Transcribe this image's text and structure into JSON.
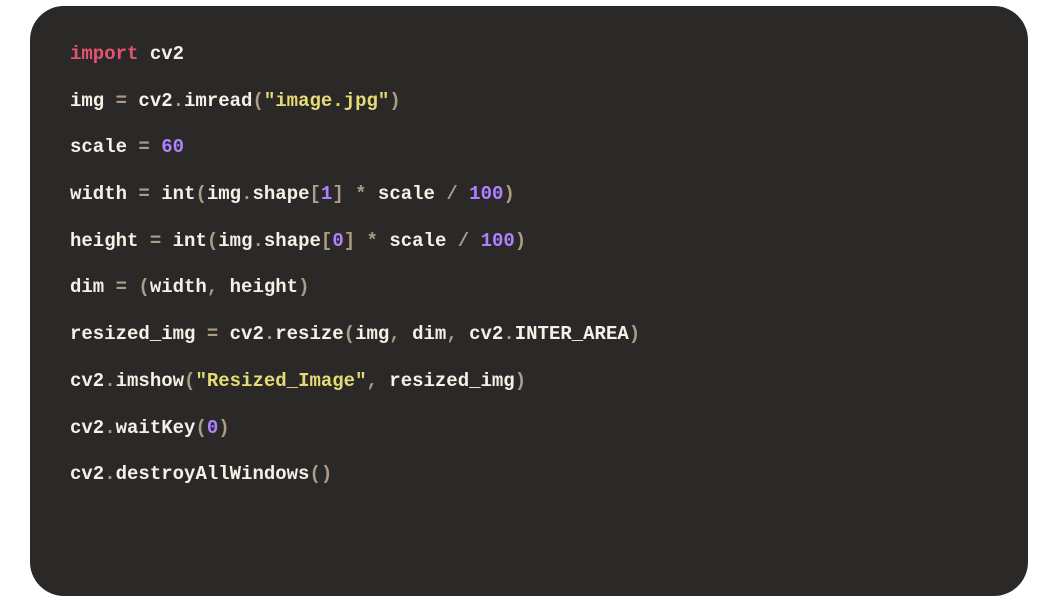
{
  "code": {
    "lines": [
      {
        "tokens": [
          {
            "c": "tok-keyword",
            "t": "import"
          },
          {
            "c": "tok-default",
            "t": " cv2"
          }
        ]
      },
      {
        "tokens": [
          {
            "c": "tok-default",
            "t": "img "
          },
          {
            "c": "tok-punct",
            "t": "="
          },
          {
            "c": "tok-default",
            "t": " cv2"
          },
          {
            "c": "tok-punct",
            "t": "."
          },
          {
            "c": "tok-func",
            "t": "imread"
          },
          {
            "c": "tok-punct",
            "t": "("
          },
          {
            "c": "tok-string",
            "t": "\"image.jpg\""
          },
          {
            "c": "tok-punct",
            "t": ")"
          }
        ]
      },
      {
        "tokens": [
          {
            "c": "tok-default",
            "t": "scale "
          },
          {
            "c": "tok-punct",
            "t": "="
          },
          {
            "c": "tok-default",
            "t": " "
          },
          {
            "c": "tok-number",
            "t": "60"
          }
        ]
      },
      {
        "tokens": [
          {
            "c": "tok-default",
            "t": "width "
          },
          {
            "c": "tok-punct",
            "t": "="
          },
          {
            "c": "tok-default",
            "t": " "
          },
          {
            "c": "tok-func",
            "t": "int"
          },
          {
            "c": "tok-punct",
            "t": "("
          },
          {
            "c": "tok-default",
            "t": "img"
          },
          {
            "c": "tok-punct",
            "t": "."
          },
          {
            "c": "tok-default",
            "t": "shape"
          },
          {
            "c": "tok-punct",
            "t": "["
          },
          {
            "c": "tok-number",
            "t": "1"
          },
          {
            "c": "tok-punct",
            "t": "]"
          },
          {
            "c": "tok-default",
            "t": " "
          },
          {
            "c": "tok-punct",
            "t": "*"
          },
          {
            "c": "tok-default",
            "t": " scale "
          },
          {
            "c": "tok-punct",
            "t": "/"
          },
          {
            "c": "tok-default",
            "t": " "
          },
          {
            "c": "tok-number",
            "t": "100"
          },
          {
            "c": "tok-punct",
            "t": ")"
          }
        ]
      },
      {
        "tokens": [
          {
            "c": "tok-default",
            "t": "height "
          },
          {
            "c": "tok-punct",
            "t": "="
          },
          {
            "c": "tok-default",
            "t": " "
          },
          {
            "c": "tok-func",
            "t": "int"
          },
          {
            "c": "tok-punct",
            "t": "("
          },
          {
            "c": "tok-default",
            "t": "img"
          },
          {
            "c": "tok-punct",
            "t": "."
          },
          {
            "c": "tok-default",
            "t": "shape"
          },
          {
            "c": "tok-punct",
            "t": "["
          },
          {
            "c": "tok-number",
            "t": "0"
          },
          {
            "c": "tok-punct",
            "t": "]"
          },
          {
            "c": "tok-default",
            "t": " "
          },
          {
            "c": "tok-punct",
            "t": "*"
          },
          {
            "c": "tok-default",
            "t": " scale "
          },
          {
            "c": "tok-punct",
            "t": "/"
          },
          {
            "c": "tok-default",
            "t": " "
          },
          {
            "c": "tok-number",
            "t": "100"
          },
          {
            "c": "tok-punct",
            "t": ")"
          }
        ]
      },
      {
        "tokens": [
          {
            "c": "tok-default",
            "t": "dim "
          },
          {
            "c": "tok-punct",
            "t": "="
          },
          {
            "c": "tok-default",
            "t": " "
          },
          {
            "c": "tok-punct",
            "t": "("
          },
          {
            "c": "tok-default",
            "t": "width"
          },
          {
            "c": "tok-punct",
            "t": ","
          },
          {
            "c": "tok-default",
            "t": " height"
          },
          {
            "c": "tok-punct",
            "t": ")"
          }
        ]
      },
      {
        "tokens": [
          {
            "c": "tok-default",
            "t": "resized_img "
          },
          {
            "c": "tok-punct",
            "t": "="
          },
          {
            "c": "tok-default",
            "t": " cv2"
          },
          {
            "c": "tok-punct",
            "t": "."
          },
          {
            "c": "tok-func",
            "t": "resize"
          },
          {
            "c": "tok-punct",
            "t": "("
          },
          {
            "c": "tok-default",
            "t": "img"
          },
          {
            "c": "tok-punct",
            "t": ","
          },
          {
            "c": "tok-default",
            "t": " dim"
          },
          {
            "c": "tok-punct",
            "t": ","
          },
          {
            "c": "tok-default",
            "t": " cv2"
          },
          {
            "c": "tok-punct",
            "t": "."
          },
          {
            "c": "tok-default",
            "t": "INTER_AREA"
          },
          {
            "c": "tok-punct",
            "t": ")"
          }
        ]
      },
      {
        "tokens": [
          {
            "c": "tok-default",
            "t": "cv2"
          },
          {
            "c": "tok-punct",
            "t": "."
          },
          {
            "c": "tok-func",
            "t": "imshow"
          },
          {
            "c": "tok-punct",
            "t": "("
          },
          {
            "c": "tok-string",
            "t": "\"Resized_Image\""
          },
          {
            "c": "tok-punct",
            "t": ","
          },
          {
            "c": "tok-default",
            "t": " resized_img"
          },
          {
            "c": "tok-punct",
            "t": ")"
          }
        ]
      },
      {
        "tokens": [
          {
            "c": "tok-default",
            "t": "cv2"
          },
          {
            "c": "tok-punct",
            "t": "."
          },
          {
            "c": "tok-func",
            "t": "waitKey"
          },
          {
            "c": "tok-punct",
            "t": "("
          },
          {
            "c": "tok-number",
            "t": "0"
          },
          {
            "c": "tok-punct",
            "t": ")"
          }
        ]
      },
      {
        "tokens": [
          {
            "c": "tok-default",
            "t": "cv2"
          },
          {
            "c": "tok-punct",
            "t": "."
          },
          {
            "c": "tok-func",
            "t": "destroyAllWindows"
          },
          {
            "c": "tok-punct",
            "t": "()"
          }
        ]
      }
    ]
  }
}
